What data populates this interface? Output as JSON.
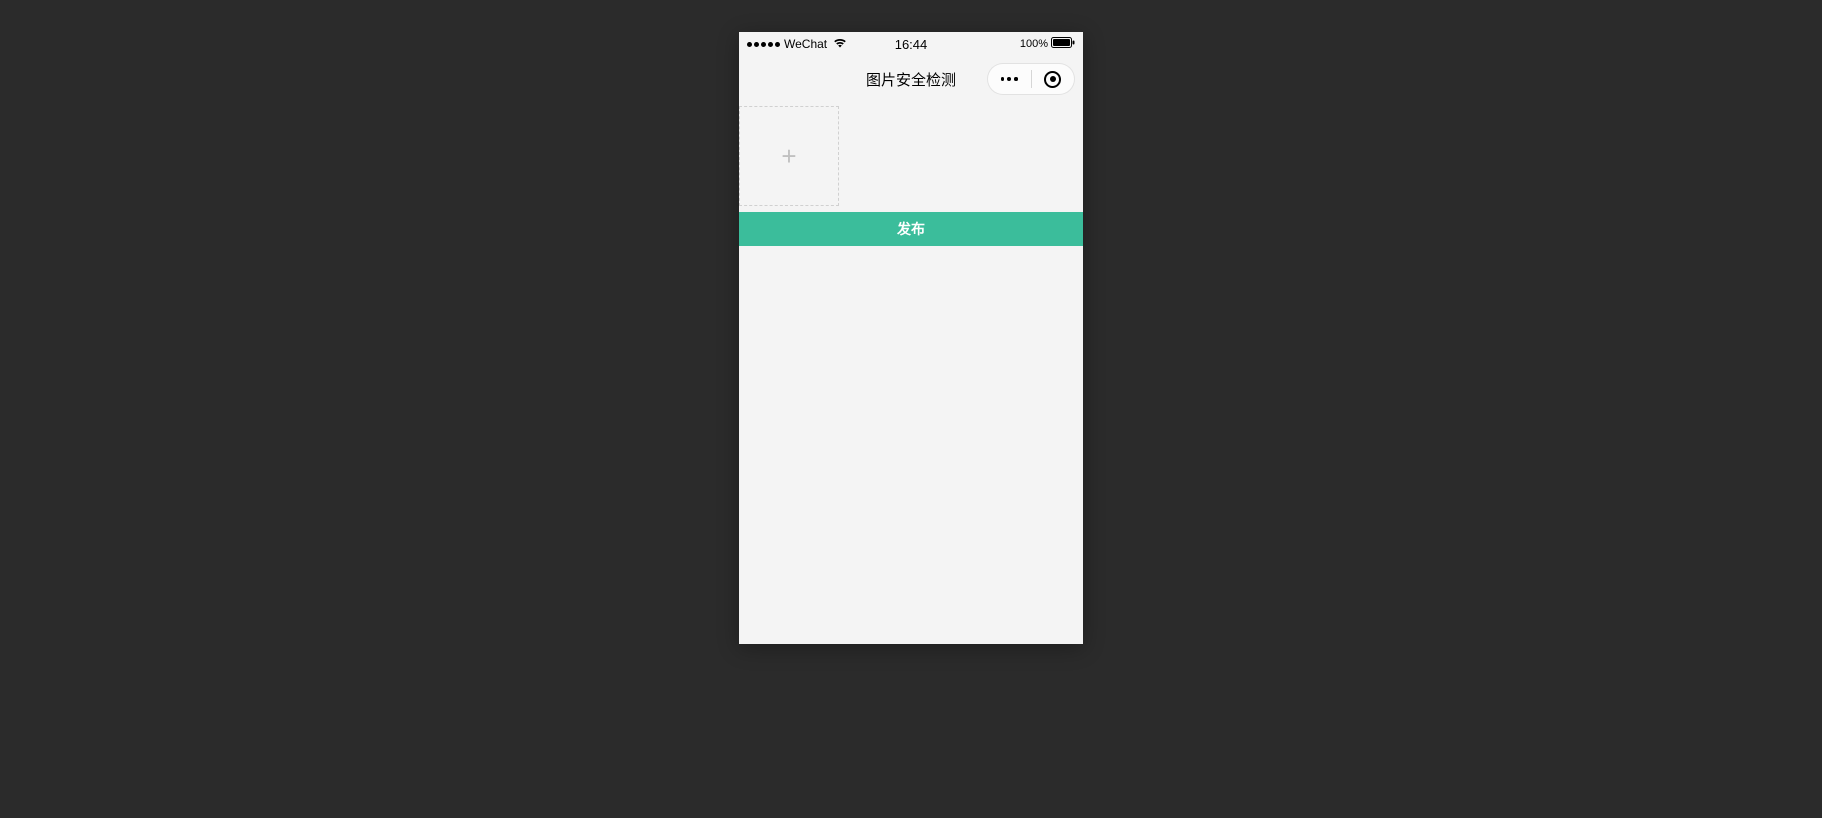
{
  "statusBar": {
    "carrier": "WeChat",
    "time": "16:44",
    "battery": "100%"
  },
  "navBar": {
    "title": "图片安全检测"
  },
  "main": {
    "publishLabel": "发布"
  }
}
